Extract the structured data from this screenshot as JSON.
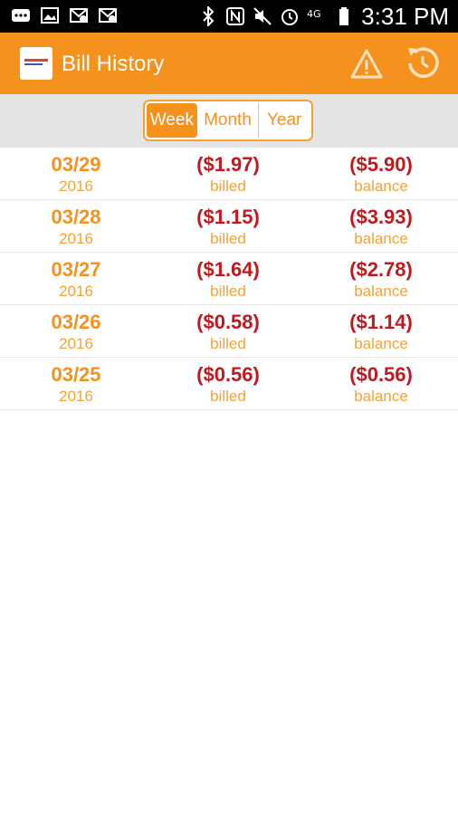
{
  "status_bar": {
    "time": "3:31 PM",
    "network": "4G"
  },
  "app_bar": {
    "title": "Bill History"
  },
  "period_selector": {
    "options": [
      "Week",
      "Month",
      "Year"
    ],
    "selected": "Week"
  },
  "rows": [
    {
      "date": "03/29",
      "year": "2016",
      "billed": "($1.97)",
      "billed_label": "billed",
      "balance": "($5.90)",
      "balance_label": "balance"
    },
    {
      "date": "03/28",
      "year": "2016",
      "billed": "($1.15)",
      "billed_label": "billed",
      "balance": "($3.93)",
      "balance_label": "balance"
    },
    {
      "date": "03/27",
      "year": "2016",
      "billed": "($1.64)",
      "billed_label": "billed",
      "balance": "($2.78)",
      "balance_label": "balance"
    },
    {
      "date": "03/26",
      "year": "2016",
      "billed": "($0.58)",
      "billed_label": "billed",
      "balance": "($1.14)",
      "balance_label": "balance"
    },
    {
      "date": "03/25",
      "year": "2016",
      "billed": "($0.56)",
      "billed_label": "billed",
      "balance": "($0.56)",
      "balance_label": "balance"
    }
  ],
  "colors": {
    "accent": "#f5921d",
    "negative": "#c0191f",
    "segment_bg": "#e4e4e4"
  }
}
